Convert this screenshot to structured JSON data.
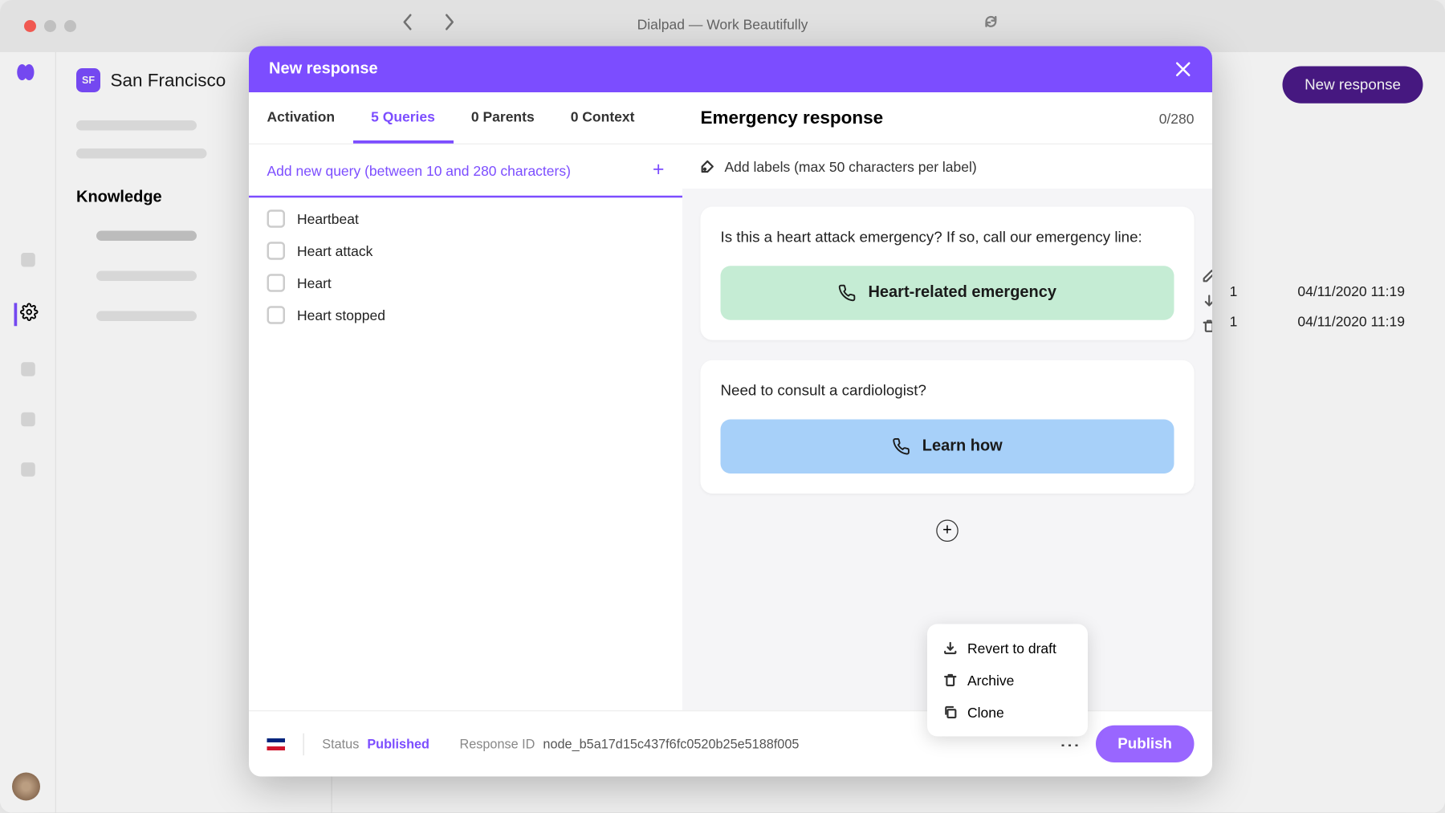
{
  "window": {
    "title": "Dialpad — Work Beautifully"
  },
  "org": {
    "badge": "SF",
    "name": "San Francisco"
  },
  "sidebar": {
    "knowledge_header": "Knowledge"
  },
  "main": {
    "new_response_btn": "New response"
  },
  "bg_table": {
    "rows": [
      {
        "num": "1",
        "date": "04/11/2020 11:19"
      },
      {
        "num": "1",
        "date": "04/11/2020 11:19"
      }
    ]
  },
  "modal": {
    "header": "New response",
    "tabs": {
      "activation": "Activation",
      "queries": "5 Queries",
      "parents": "0 Parents",
      "context": "0 Context"
    },
    "response_title": "Emergency response",
    "char_count": "0/280",
    "query_input_placeholder": "Add new query (between 10 and 280 characters)",
    "queries_list": [
      "Heartbeat",
      "Heart attack",
      "Heart",
      "Heart stopped"
    ],
    "labels_prompt": "Add labels (max 50 characters per label)",
    "cards": [
      {
        "text": "Is this a heart attack emergency? If so, call our emergency line:",
        "button": "Heart-related emergency",
        "style": "green"
      },
      {
        "text": "Need to consult a cardiologist?",
        "button": "Learn how",
        "style": "blue"
      }
    ],
    "context_menu": {
      "revert": "Revert to draft",
      "archive": "Archive",
      "clone": "Clone"
    },
    "footer": {
      "status_label": "Status",
      "status_value": "Published",
      "respid_label": "Response ID",
      "respid_value": "node_b5a17d15c437f6fc0520b25e5188f005",
      "publish": "Publish"
    }
  }
}
